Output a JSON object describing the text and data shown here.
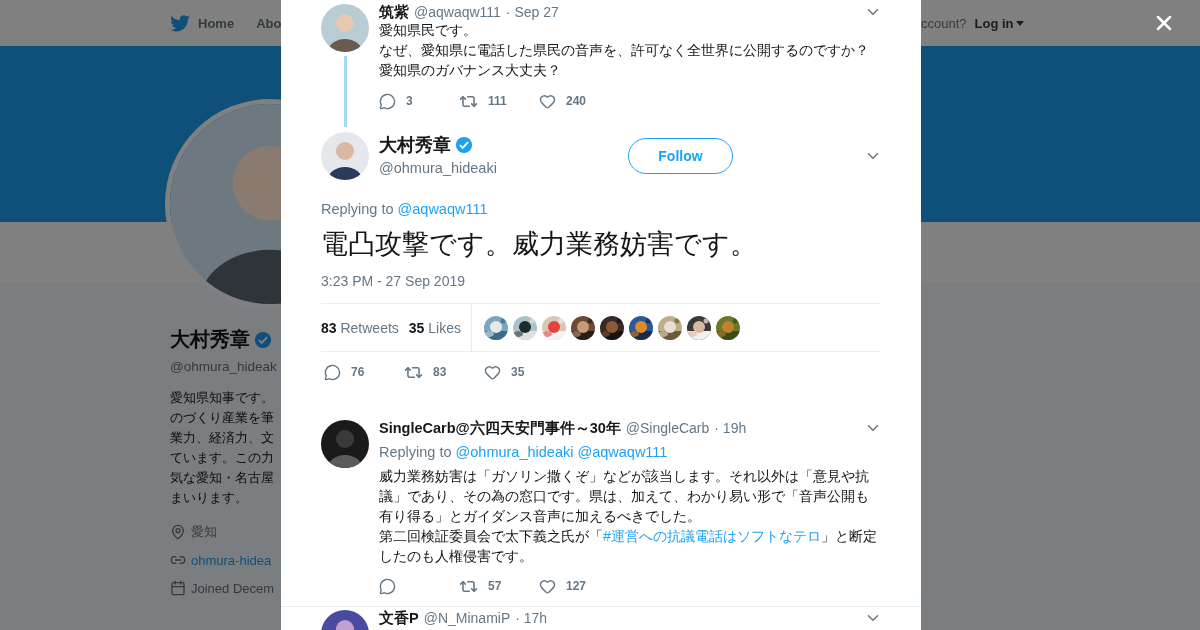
{
  "nav": {
    "items": [
      {
        "label": "Home"
      },
      {
        "label": "Abo"
      }
    ],
    "account_prompt": "ccount?",
    "login": "Log in"
  },
  "profile": {
    "name": "大村秀章",
    "verified": true,
    "handle": "@ohmura_hideak",
    "bio": [
      "愛知県知事です。",
      "のづくり産業を筆",
      "業力、経済力、文",
      "ています。この力",
      "気な愛知・名古屋",
      "まいります。"
    ],
    "location": "愛知",
    "link": "ohmura-hidea",
    "joined": "Joined Decem"
  },
  "parent": {
    "name": "筑紫",
    "handle": "@aqwaqw111",
    "time": "· Sep 27",
    "text": [
      "愛知県民です。",
      "なぜ、愛知県に電話した県民の音声を、許可なく全世界に公開するのですか？",
      "愛知県のガバナンス大丈夫？"
    ],
    "actions": {
      "replies": "3",
      "retweets": "111",
      "likes": "240"
    }
  },
  "focus": {
    "name": "大村秀章",
    "verified": true,
    "handle": "@ohmura_hideaki",
    "follow": "Follow",
    "replying_label": "Replying to",
    "replying_to": [
      "@aqwaqw111"
    ],
    "text": "電凸攻撃です。威力業務妨害です。",
    "timestamp": "3:23 PM - 27 Sep 2019",
    "retweets_count": "83",
    "retweets_label": "Retweets",
    "likes_count": "35",
    "likes_label": "Likes",
    "likers": [
      {
        "kind": "picture"
      },
      {
        "kind": "picture"
      },
      {
        "kind": "picture"
      },
      {
        "kind": "picture"
      },
      {
        "kind": "picture"
      },
      {
        "kind": "picture"
      },
      {
        "kind": "picture"
      },
      {
        "kind": "picture"
      },
      {
        "kind": "picture"
      }
    ],
    "actions": {
      "replies": "76",
      "retweets": "83",
      "likes": "35"
    }
  },
  "replies": [
    {
      "name": "SingleCarb@六四天安門事件～30年",
      "handle": "@SingleCarb",
      "time": "· 19h",
      "replying_label": "Replying to",
      "replying_to": [
        "@ohmura_hideaki",
        "@aqwaqw111"
      ],
      "text": [
        "威力業務妨害は「ガソリン撒くぞ」などが該当します。それ以外は「意見や抗",
        "議」であり、その為の窓口です。県は、加えて、わかり易い形で「音声公開も",
        "有り得る」とガイダンス音声に加えるべきでした。"
      ],
      "text2_before": "第二回検証委員会で太下義之氏が「",
      "hashtag": "#運営への抗議電話はソフトなテロ",
      "text2_after": "」と断定",
      "text3": "したのも人権侵害です。",
      "actions": {
        "retweets": "57",
        "likes": "127"
      }
    },
    {
      "name": "文香P",
      "handle": "@N_MinamiP",
      "time": "· 17h"
    }
  ]
}
